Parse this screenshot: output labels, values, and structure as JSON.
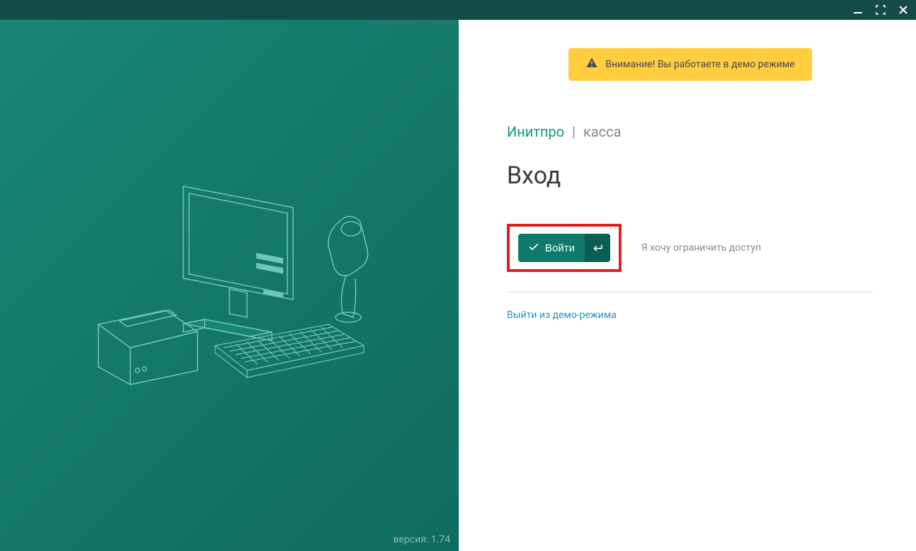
{
  "warning": {
    "text": "Внимание! Вы работаете в демо режиме"
  },
  "brand": {
    "name": "Инитпро",
    "separator": "|",
    "sub": "касса"
  },
  "page": {
    "title": "Вход"
  },
  "login": {
    "button_label": "Войти",
    "restrict_link": "Я хочу ограничить доступ"
  },
  "links": {
    "exit_demo": "Выйти из демо-режима"
  },
  "footer": {
    "version": "версия: 1.74"
  }
}
